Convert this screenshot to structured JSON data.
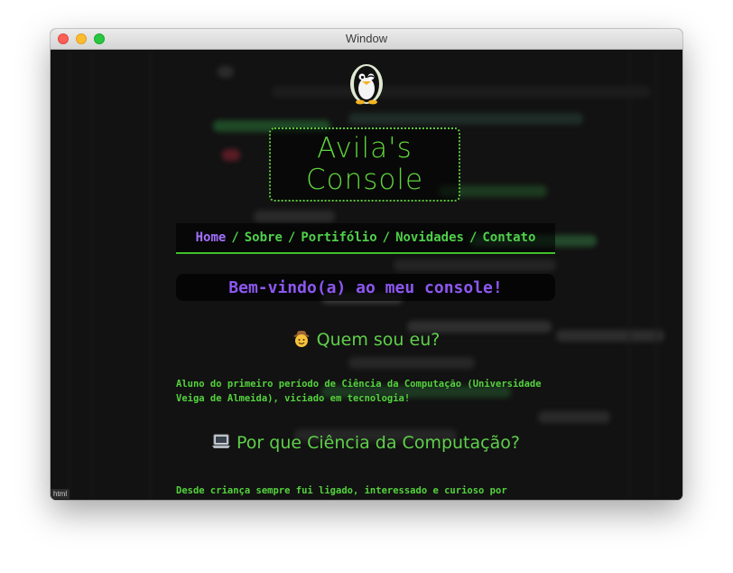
{
  "window": {
    "title": "Window"
  },
  "site": {
    "logo_line1": "Avila's",
    "logo_line2": "Console",
    "nav": [
      "Home",
      "Sobre",
      "Portifólio",
      "Novidades",
      "Contato"
    ],
    "nav_separator": "/",
    "welcome": "Bem-vindo(a) ao meu console!",
    "sections": [
      {
        "title": "Quem sou eu?",
        "icon": "cowboy-face-icon",
        "text": "Aluno do primeiro período de Ciência da Computação (Universidade Veiga de Almeida), viciado em tecnologia!"
      },
      {
        "title": "Por que Ciência da Computação?",
        "icon": "laptop-icon",
        "text": "Desde criança sempre fui ligado, interessado e curioso por tecnologia. O"
      }
    ]
  },
  "status_badge": "html",
  "colors": {
    "accent_green": "#4fd04a",
    "accent_purple": "#a371ff",
    "background": "#121212"
  }
}
